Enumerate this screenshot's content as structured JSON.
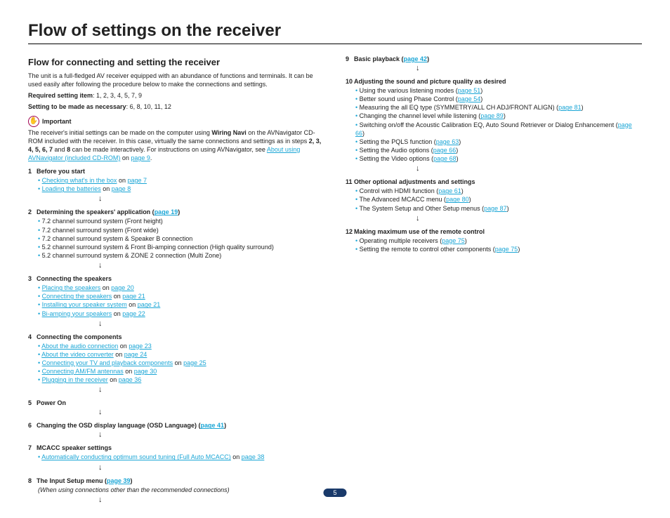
{
  "title": "Flow of settings on the receiver",
  "subtitle": "Flow for connecting and setting the receiver",
  "intro": "The unit is a full-fledged AV receiver equipped with an abundance of functions and terminals. It can be used easily after following the procedure below to make the connections and settings.",
  "required_label": "Required setting item",
  "required_value": ": 1, 2, 3, 4, 5, 7, 9",
  "optional_label": "Setting to be made as necessary",
  "optional_value": ": 6, 8, 10, 11, 12",
  "important_label": "Important",
  "important_body_pre": "The receiver's initial settings can be made on the computer using ",
  "important_wiring": "Wiring Navi",
  "important_body_mid": " on the AVNavigator CD-ROM included with the receiver. In this case, virtually the same connections and settings as in steps ",
  "important_steps": "2, 3, 4, 5, 6, 7",
  "important_body_mid2": " and ",
  "important_step8": "8",
  "important_body_post": " can be made interactively. For instructions on using AVNavigator, see ",
  "important_link": "About using AVNavigator (included CD-ROM)",
  "important_on": " on ",
  "important_page": "page 9",
  "s1_num": "1",
  "s1_title": "Before you start",
  "s1_b1a": "Checking what's in the box",
  "s1_b1b": " on ",
  "s1_b1c": "page 7",
  "s1_b2a": "Loading the batteries",
  "s1_b2b": " on ",
  "s1_b2c": "page 8",
  "s2_num": "2",
  "s2_title_a": "Determining the speakers' application (",
  "s2_title_b": "page 19",
  "s2_title_c": ")",
  "s2_b1": "7.2 channel surround system (Front height)",
  "s2_b2": "7.2 channel surround system (Front wide)",
  "s2_b3": "7.2 channel surround system & Speaker B connection",
  "s2_b4": "5.2 channel surround system & Front Bi-amping connection (High quality surround)",
  "s2_b5": "5.2 channel surround system & ZONE 2 connection (Multi Zone)",
  "s3_num": "3",
  "s3_title": "Connecting the speakers",
  "s3_b1a": "Placing the speakers",
  "s3_b1b": " on ",
  "s3_b1c": "page 20",
  "s3_b2a": "Connecting the speakers",
  "s3_b2b": " on ",
  "s3_b2c": "page 21",
  "s3_b3a": "Installing your speaker system",
  "s3_b3b": " on ",
  "s3_b3c": "page 21",
  "s3_b4a": "Bi-amping your speakers",
  "s3_b4b": " on ",
  "s3_b4c": "page 22",
  "s4_num": "4",
  "s4_title": "Connecting the components",
  "s4_b1a": "About the audio connection",
  "s4_b1b": " on ",
  "s4_b1c": "page 23",
  "s4_b2a": "About the video converter",
  "s4_b2b": " on ",
  "s4_b2c": "page 24",
  "s4_b3a": "Connecting your TV and playback components",
  "s4_b3b": " on ",
  "s4_b3c": "page 25",
  "s4_b4a": "Connecting AM/FM antennas",
  "s4_b4b": " on ",
  "s4_b4c": "page 30",
  "s4_b5a": "Plugging in the receiver",
  "s4_b5b": " on ",
  "s4_b5c": "page 36",
  "s5_num": "5",
  "s5_title": "Power On",
  "s6_num": "6",
  "s6_title_a": "Changing the OSD display language (OSD Language) (",
  "s6_title_b": "page 41",
  "s6_title_c": ")",
  "s7_num": "7",
  "s7_title": "MCACC speaker settings",
  "s7_b1a": "Automatically conducting optimum sound tuning (Full Auto MCACC)",
  "s7_b1b": " on ",
  "s7_b1c": "page 38",
  "s8_num": "8",
  "s8_title_a": "The Input Setup menu (",
  "s8_title_b": "page 39",
  "s8_title_c": ")",
  "s8_note": "(When using connections other than the recommended connections)",
  "s9_num": "9",
  "s9_title_a": "Basic playback (",
  "s9_title_b": "page 42",
  "s9_title_c": ")",
  "s10_num": "10",
  "s10_title": "Adjusting the sound and picture quality as desired",
  "s10_b1a": "Using the various listening modes (",
  "s10_b1b": "page 51",
  "s10_b1c": ")",
  "s10_b2a": "Better sound using Phase Control (",
  "s10_b2b": "page 54",
  "s10_b2c": ")",
  "s10_b3a": "Measuring the all EQ type (SYMMETRY/ALL CH ADJ/FRONT ALIGN) (",
  "s10_b3b": "page 81",
  "s10_b3c": ")",
  "s10_b4a": "Changing the channel level while listening (",
  "s10_b4b": "page 89",
  "s10_b4c": ")",
  "s10_b5a": "Switching on/off the Acoustic Calibration EQ, Auto Sound Retriever or Dialog Enhancement (",
  "s10_b5b": "page 66",
  "s10_b5c": ")",
  "s10_b6a": "Setting the PQLS function (",
  "s10_b6b": "page 63",
  "s10_b6c": ")",
  "s10_b7a": "Setting the Audio options (",
  "s10_b7b": "page 66",
  "s10_b7c": ")",
  "s10_b8a": "Setting the Video options (",
  "s10_b8b": "page 68",
  "s10_b8c": ")",
  "s11_num": "11",
  "s11_title": "Other optional adjustments and settings",
  "s11_b1a": "Control with HDMI function (",
  "s11_b1b": "page 61",
  "s11_b1c": ")",
  "s11_b2a": "The Advanced MCACC menu (",
  "s11_b2b": "page 80",
  "s11_b2c": ")",
  "s11_b3a": "The System Setup and Other Setup menus (",
  "s11_b3b": "page 87",
  "s11_b3c": ")",
  "s12_num": "12",
  "s12_title": "Making maximum use of the remote control",
  "s12_b1a": "Operating multiple receivers (",
  "s12_b1b": "page 75",
  "s12_b1c": ")",
  "s12_b2a": "Setting the remote to control other components (",
  "s12_b2b": "page 75",
  "s12_b2c": ")",
  "page_number": "5"
}
